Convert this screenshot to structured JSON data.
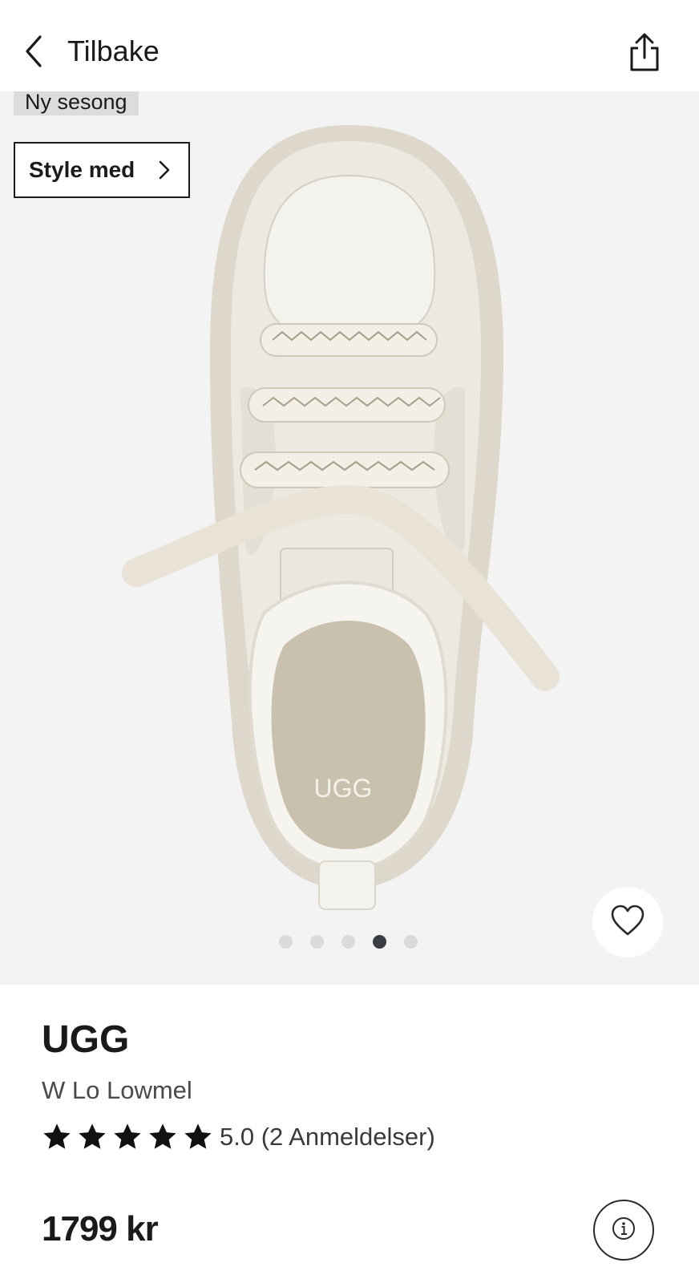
{
  "nav": {
    "back_label": "Tilbake",
    "back_icon": "chevron-left-icon",
    "share_icon": "share-icon"
  },
  "gallery": {
    "badge": "Ny sesong",
    "style_button_label": "Style med",
    "style_button_icon": "chevron-right-icon",
    "image_logo_text": "UGG",
    "pagination": {
      "total": 5,
      "active_index": 3
    },
    "favorite_icon": "heart-icon"
  },
  "product": {
    "brand": "UGG",
    "model": "W Lo Lowmel",
    "rating": {
      "stars": 5,
      "text": "5.0 (2 Anmeldelser)"
    },
    "price": "1799 kr",
    "info_icon": "info-icon"
  },
  "colors": {
    "background": "#ffffff",
    "gallery_background": "#f3f3f3",
    "badge_background": "#dcdcdc",
    "text": "#1a1a1a",
    "active_dot": "#3a3d44",
    "inactive_dot": "#dadada"
  }
}
